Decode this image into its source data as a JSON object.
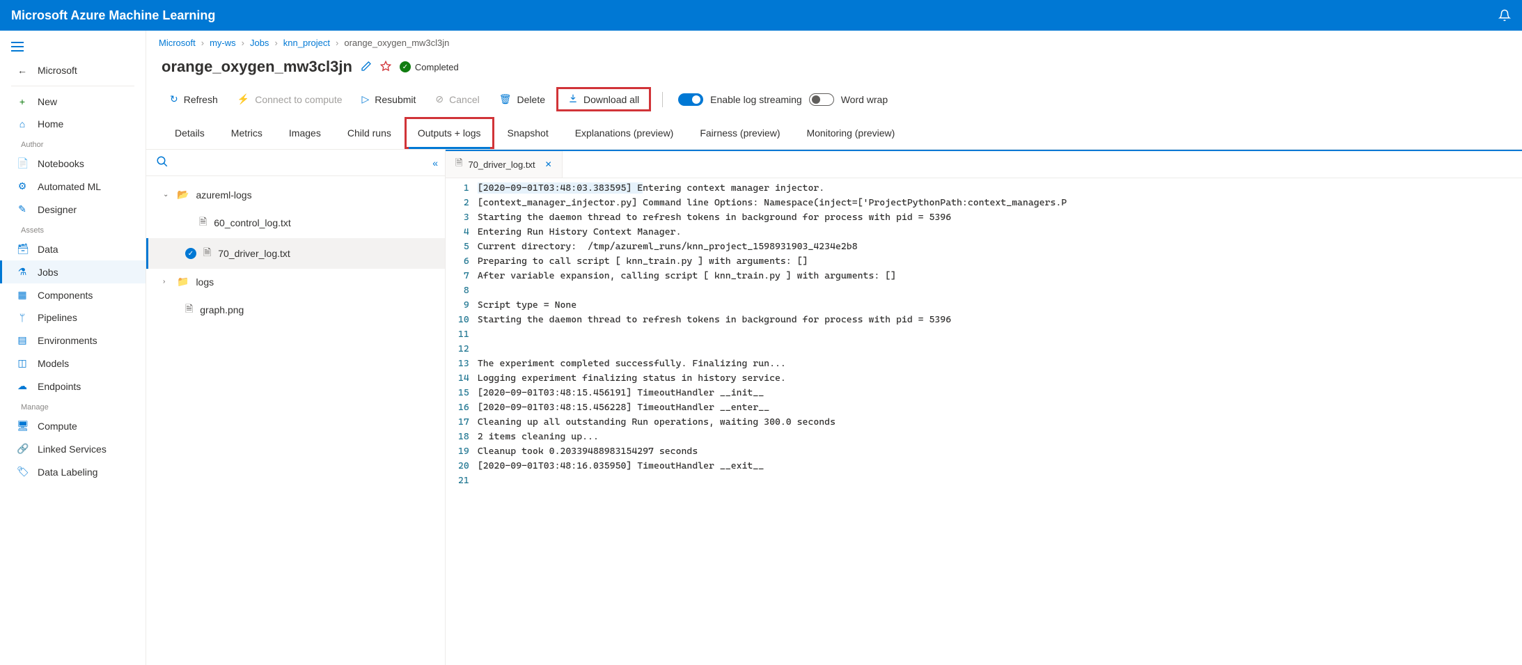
{
  "topbar": {
    "title": "Microsoft Azure Machine Learning"
  },
  "nav": {
    "back": "Microsoft",
    "items_top": [
      {
        "label": "New",
        "icon": "+",
        "cls": "green"
      },
      {
        "label": "Home",
        "icon": "⌂",
        "cls": "blue"
      }
    ],
    "section_author": "Author",
    "items_author": [
      {
        "label": "Notebooks",
        "icon": "📄"
      },
      {
        "label": "Automated ML",
        "icon": "⚙"
      },
      {
        "label": "Designer",
        "icon": "✎"
      }
    ],
    "section_assets": "Assets",
    "items_assets": [
      {
        "label": "Data",
        "icon": "🗃"
      },
      {
        "label": "Jobs",
        "icon": "⚗",
        "active": true
      },
      {
        "label": "Components",
        "icon": "▦"
      },
      {
        "label": "Pipelines",
        "icon": "ᛘ"
      },
      {
        "label": "Environments",
        "icon": "▤"
      },
      {
        "label": "Models",
        "icon": "◫"
      },
      {
        "label": "Endpoints",
        "icon": "☁"
      }
    ],
    "section_manage": "Manage",
    "items_manage": [
      {
        "label": "Compute",
        "icon": "🖥"
      },
      {
        "label": "Linked Services",
        "icon": "🔗"
      },
      {
        "label": "Data Labeling",
        "icon": "🏷"
      }
    ]
  },
  "breadcrumbs": [
    "Microsoft",
    "my-ws",
    "Jobs",
    "knn_project",
    "orange_oxygen_mw3cl3jn"
  ],
  "page": {
    "title": "orange_oxygen_mw3cl3jn",
    "status": "Completed"
  },
  "toolbar": {
    "refresh": "Refresh",
    "connect": "Connect to compute",
    "resubmit": "Resubmit",
    "cancel": "Cancel",
    "delete": "Delete",
    "download_all": "Download all",
    "log_stream": "Enable log streaming",
    "word_wrap": "Word wrap"
  },
  "tabs": [
    "Details",
    "Metrics",
    "Images",
    "Child runs",
    "Outputs + logs",
    "Snapshot",
    "Explanations (preview)",
    "Fairness (preview)",
    "Monitoring (preview)"
  ],
  "active_tab": "Outputs + logs",
  "tree": {
    "root1": "azureml-logs",
    "root1_children": [
      "60_control_log.txt",
      "70_driver_log.txt"
    ],
    "root1_selected": "70_driver_log.txt",
    "root2": "logs",
    "file1": "graph.png"
  },
  "editor": {
    "tab_name": "70_driver_log.txt",
    "lines": [
      "[2020-09-01T03:48:03.383595] Entering context manager injector.",
      "[context_manager_injector.py] Command line Options: Namespace(inject=['ProjectPythonPath:context_managers.P",
      "Starting the daemon thread to refresh tokens in background for process with pid = 5396",
      "Entering Run History Context Manager.",
      "Current directory:  /tmp/azureml_runs/knn_project_1598931903_4234e2b8",
      "Preparing to call script [ knn_train.py ] with arguments: []",
      "After variable expansion, calling script [ knn_train.py ] with arguments: []",
      "",
      "Script type = None",
      "Starting the daemon thread to refresh tokens in background for process with pid = 5396",
      "",
      "",
      "The experiment completed successfully. Finalizing run...",
      "Logging experiment finalizing status in history service.",
      "[2020-09-01T03:48:15.456191] TimeoutHandler __init__",
      "[2020-09-01T03:48:15.456228] TimeoutHandler __enter__",
      "Cleaning up all outstanding Run operations, waiting 300.0 seconds",
      "2 items cleaning up...",
      "Cleanup took 0.20339488983154297 seconds",
      "[2020-09-01T03:48:16.035950] TimeoutHandler __exit__",
      ""
    ]
  }
}
